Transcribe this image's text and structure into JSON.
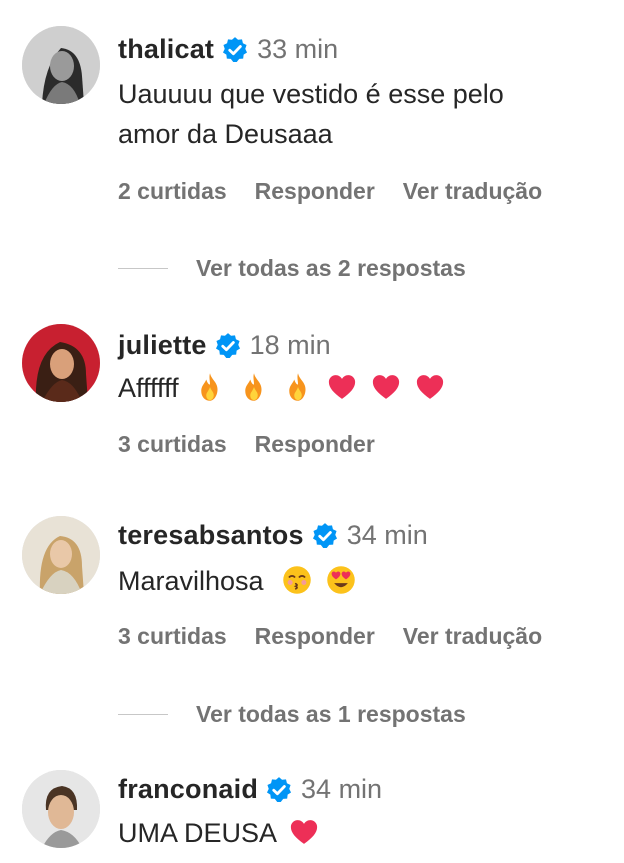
{
  "comments": [
    {
      "username": "thalicat",
      "time": "33 min",
      "text_line1": "Uauuuu que vestido é esse pelo",
      "text_line2": "amor da Deusaaa",
      "likes": "2 curtidas",
      "reply_label": "Responder",
      "translate_label": "Ver tradução",
      "replies_label": "Ver todas as 2 respostas"
    },
    {
      "username": "juliette",
      "time": "18 min",
      "text": "Affffff",
      "emojis": [
        "fire-emoji",
        "fire-emoji",
        "fire-emoji",
        "heart-emoji",
        "heart-emoji",
        "heart-emoji"
      ],
      "likes": "3 curtidas",
      "reply_label": "Responder"
    },
    {
      "username": "teresabsantos",
      "time": "34 min",
      "text": "Maravilhosa",
      "emojis": [
        "kissing-face-emoji",
        "heart-eyes-emoji"
      ],
      "likes": "3 curtidas",
      "reply_label": "Responder",
      "translate_label": "Ver tradução",
      "replies_label": "Ver todas as 1 respostas"
    },
    {
      "username": "franconaid",
      "time": "34 min",
      "text": "UMA DEUSA",
      "emojis": [
        "heart-emoji"
      ]
    }
  ],
  "colors": {
    "text": "#262626",
    "secondary": "#737373",
    "verified": "#0095f6",
    "heart": "#ed2f57",
    "fire": "#f7941d"
  }
}
